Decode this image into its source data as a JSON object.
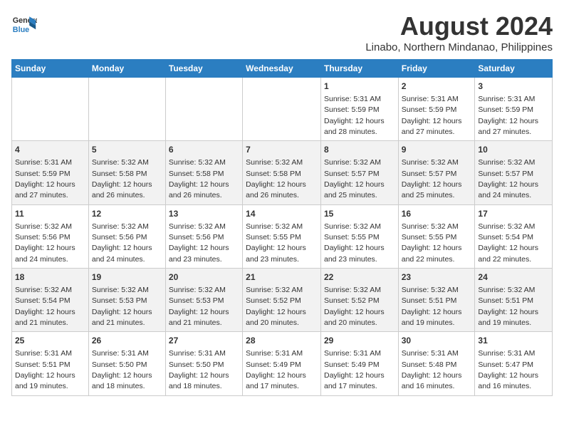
{
  "logo": {
    "line1": "General",
    "line2": "Blue"
  },
  "title": "August 2024",
  "subtitle": "Linabo, Northern Mindanao, Philippines",
  "days_of_week": [
    "Sunday",
    "Monday",
    "Tuesday",
    "Wednesday",
    "Thursday",
    "Friday",
    "Saturday"
  ],
  "weeks": [
    [
      {
        "day": "",
        "info": ""
      },
      {
        "day": "",
        "info": ""
      },
      {
        "day": "",
        "info": ""
      },
      {
        "day": "",
        "info": ""
      },
      {
        "day": "1",
        "info": "Sunrise: 5:31 AM\nSunset: 5:59 PM\nDaylight: 12 hours and 28 minutes."
      },
      {
        "day": "2",
        "info": "Sunrise: 5:31 AM\nSunset: 5:59 PM\nDaylight: 12 hours and 27 minutes."
      },
      {
        "day": "3",
        "info": "Sunrise: 5:31 AM\nSunset: 5:59 PM\nDaylight: 12 hours and 27 minutes."
      }
    ],
    [
      {
        "day": "4",
        "info": "Sunrise: 5:31 AM\nSunset: 5:59 PM\nDaylight: 12 hours and 27 minutes."
      },
      {
        "day": "5",
        "info": "Sunrise: 5:32 AM\nSunset: 5:58 PM\nDaylight: 12 hours and 26 minutes."
      },
      {
        "day": "6",
        "info": "Sunrise: 5:32 AM\nSunset: 5:58 PM\nDaylight: 12 hours and 26 minutes."
      },
      {
        "day": "7",
        "info": "Sunrise: 5:32 AM\nSunset: 5:58 PM\nDaylight: 12 hours and 26 minutes."
      },
      {
        "day": "8",
        "info": "Sunrise: 5:32 AM\nSunset: 5:57 PM\nDaylight: 12 hours and 25 minutes."
      },
      {
        "day": "9",
        "info": "Sunrise: 5:32 AM\nSunset: 5:57 PM\nDaylight: 12 hours and 25 minutes."
      },
      {
        "day": "10",
        "info": "Sunrise: 5:32 AM\nSunset: 5:57 PM\nDaylight: 12 hours and 24 minutes."
      }
    ],
    [
      {
        "day": "11",
        "info": "Sunrise: 5:32 AM\nSunset: 5:56 PM\nDaylight: 12 hours and 24 minutes."
      },
      {
        "day": "12",
        "info": "Sunrise: 5:32 AM\nSunset: 5:56 PM\nDaylight: 12 hours and 24 minutes."
      },
      {
        "day": "13",
        "info": "Sunrise: 5:32 AM\nSunset: 5:56 PM\nDaylight: 12 hours and 23 minutes."
      },
      {
        "day": "14",
        "info": "Sunrise: 5:32 AM\nSunset: 5:55 PM\nDaylight: 12 hours and 23 minutes."
      },
      {
        "day": "15",
        "info": "Sunrise: 5:32 AM\nSunset: 5:55 PM\nDaylight: 12 hours and 23 minutes."
      },
      {
        "day": "16",
        "info": "Sunrise: 5:32 AM\nSunset: 5:55 PM\nDaylight: 12 hours and 22 minutes."
      },
      {
        "day": "17",
        "info": "Sunrise: 5:32 AM\nSunset: 5:54 PM\nDaylight: 12 hours and 22 minutes."
      }
    ],
    [
      {
        "day": "18",
        "info": "Sunrise: 5:32 AM\nSunset: 5:54 PM\nDaylight: 12 hours and 21 minutes."
      },
      {
        "day": "19",
        "info": "Sunrise: 5:32 AM\nSunset: 5:53 PM\nDaylight: 12 hours and 21 minutes."
      },
      {
        "day": "20",
        "info": "Sunrise: 5:32 AM\nSunset: 5:53 PM\nDaylight: 12 hours and 21 minutes."
      },
      {
        "day": "21",
        "info": "Sunrise: 5:32 AM\nSunset: 5:52 PM\nDaylight: 12 hours and 20 minutes."
      },
      {
        "day": "22",
        "info": "Sunrise: 5:32 AM\nSunset: 5:52 PM\nDaylight: 12 hours and 20 minutes."
      },
      {
        "day": "23",
        "info": "Sunrise: 5:32 AM\nSunset: 5:51 PM\nDaylight: 12 hours and 19 minutes."
      },
      {
        "day": "24",
        "info": "Sunrise: 5:32 AM\nSunset: 5:51 PM\nDaylight: 12 hours and 19 minutes."
      }
    ],
    [
      {
        "day": "25",
        "info": "Sunrise: 5:31 AM\nSunset: 5:51 PM\nDaylight: 12 hours and 19 minutes."
      },
      {
        "day": "26",
        "info": "Sunrise: 5:31 AM\nSunset: 5:50 PM\nDaylight: 12 hours and 18 minutes."
      },
      {
        "day": "27",
        "info": "Sunrise: 5:31 AM\nSunset: 5:50 PM\nDaylight: 12 hours and 18 minutes."
      },
      {
        "day": "28",
        "info": "Sunrise: 5:31 AM\nSunset: 5:49 PM\nDaylight: 12 hours and 17 minutes."
      },
      {
        "day": "29",
        "info": "Sunrise: 5:31 AM\nSunset: 5:49 PM\nDaylight: 12 hours and 17 minutes."
      },
      {
        "day": "30",
        "info": "Sunrise: 5:31 AM\nSunset: 5:48 PM\nDaylight: 12 hours and 16 minutes."
      },
      {
        "day": "31",
        "info": "Sunrise: 5:31 AM\nSunset: 5:47 PM\nDaylight: 12 hours and 16 minutes."
      }
    ]
  ]
}
